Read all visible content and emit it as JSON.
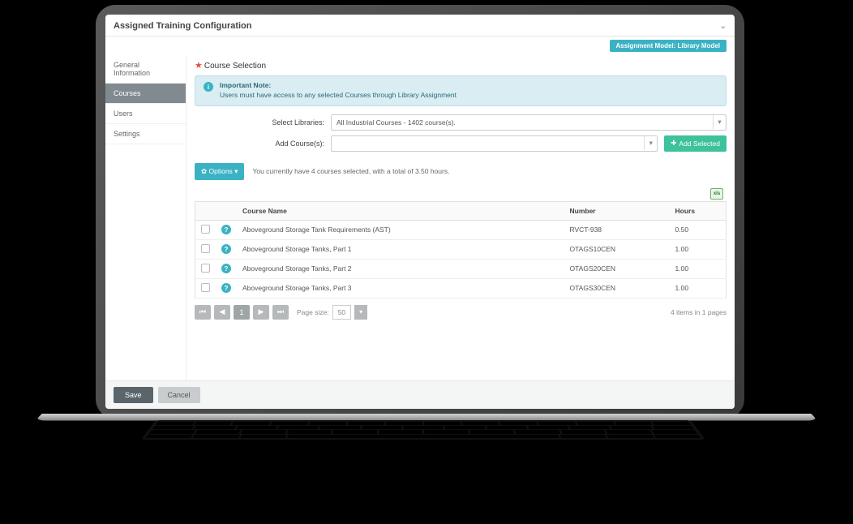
{
  "header": {
    "title": "Assigned Training Configuration",
    "badge": "Assignment Model: Library Model"
  },
  "sidebar": {
    "items": [
      {
        "label": "General Information"
      },
      {
        "label": "Courses"
      },
      {
        "label": "Users"
      },
      {
        "label": "Settings"
      }
    ]
  },
  "section": {
    "title": "Course Selection"
  },
  "note": {
    "title": "Important Note:",
    "body": "Users must have access to any selected Courses through Library Assignment"
  },
  "form": {
    "select_libraries_label": "Select Libraries:",
    "select_libraries_value": "All Industrial Courses - 1402 course(s).",
    "add_courses_label": "Add Course(s):",
    "add_courses_value": "",
    "add_selected_btn": "Add Selected"
  },
  "options": {
    "btn": "Options",
    "summary": "You currently have 4 courses selected, with a total of 3.50 hours."
  },
  "table": {
    "columns": {
      "name": "Course Name",
      "number": "Number",
      "hours": "Hours"
    },
    "rows": [
      {
        "name": "Aboveground Storage Tank Requirements (AST)",
        "number": "RVCT-938",
        "hours": "0.50"
      },
      {
        "name": "Aboveground Storage Tanks, Part 1",
        "number": "OTAGS10CEN",
        "hours": "1.00"
      },
      {
        "name": "Aboveground Storage Tanks, Part 2",
        "number": "OTAGS20CEN",
        "hours": "1.00"
      },
      {
        "name": "Aboveground Storage Tanks, Part 3",
        "number": "OTAGS30CEN",
        "hours": "1.00"
      }
    ]
  },
  "pager": {
    "current": "1",
    "size_label": "Page size:",
    "size_value": "50",
    "info": "4 items in 1 pages"
  },
  "footer": {
    "save": "Save",
    "cancel": "Cancel"
  }
}
